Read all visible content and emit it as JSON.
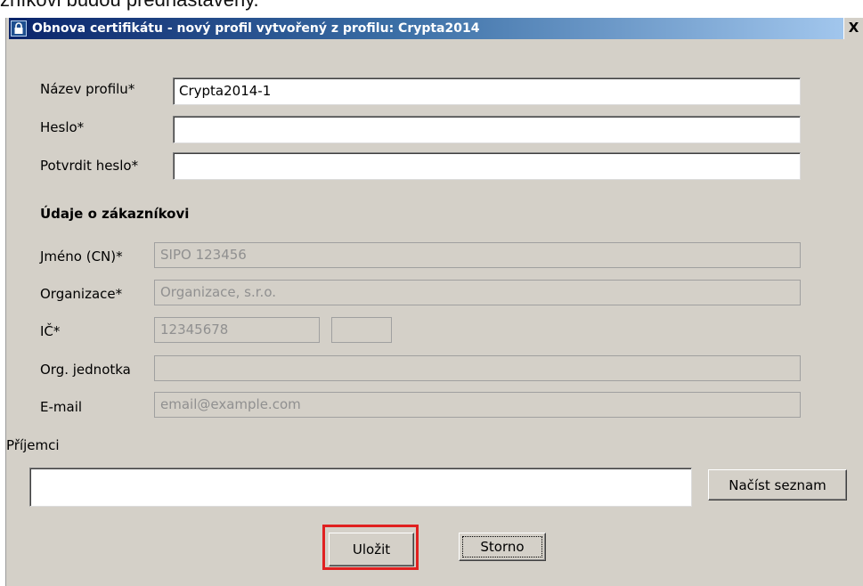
{
  "background_doc_text": "zníkovi budou přednastaveny.",
  "window": {
    "title": "Obnova certifikátu  -  nový profil vytvořený z profilu: Crypta2014",
    "close_label": "X"
  },
  "profile": {
    "name_label": "Název profilu*",
    "name_value": "Crypta2014-1",
    "password_label": "Heslo*",
    "password_value": "",
    "confirm_label": "Potvrdit heslo*",
    "confirm_value": ""
  },
  "customer": {
    "section_title": "Údaje o zákazníkovi",
    "cn_label": "Jméno (CN)*",
    "cn_value": "SIPO 123456",
    "org_label": "Organizace*",
    "org_value": "Organizace, s.r.o.",
    "ic_label": "IČ*",
    "ic_value": "12345678",
    "ic_suffix_value": "",
    "unit_label": "Org. jednotka",
    "unit_value": "",
    "email_label": "E-mail",
    "email_value": "email@example.com"
  },
  "recipients": {
    "label": "Příjemci",
    "value": "",
    "load_button": "Načíst seznam"
  },
  "footer": {
    "save_button": "Uložit",
    "cancel_button": "Storno"
  },
  "colors": {
    "dialog_bg": "#d4d0c8",
    "titlebar_start": "#0a246a",
    "titlebar_end": "#a6caf0",
    "highlight": "#e02020"
  }
}
